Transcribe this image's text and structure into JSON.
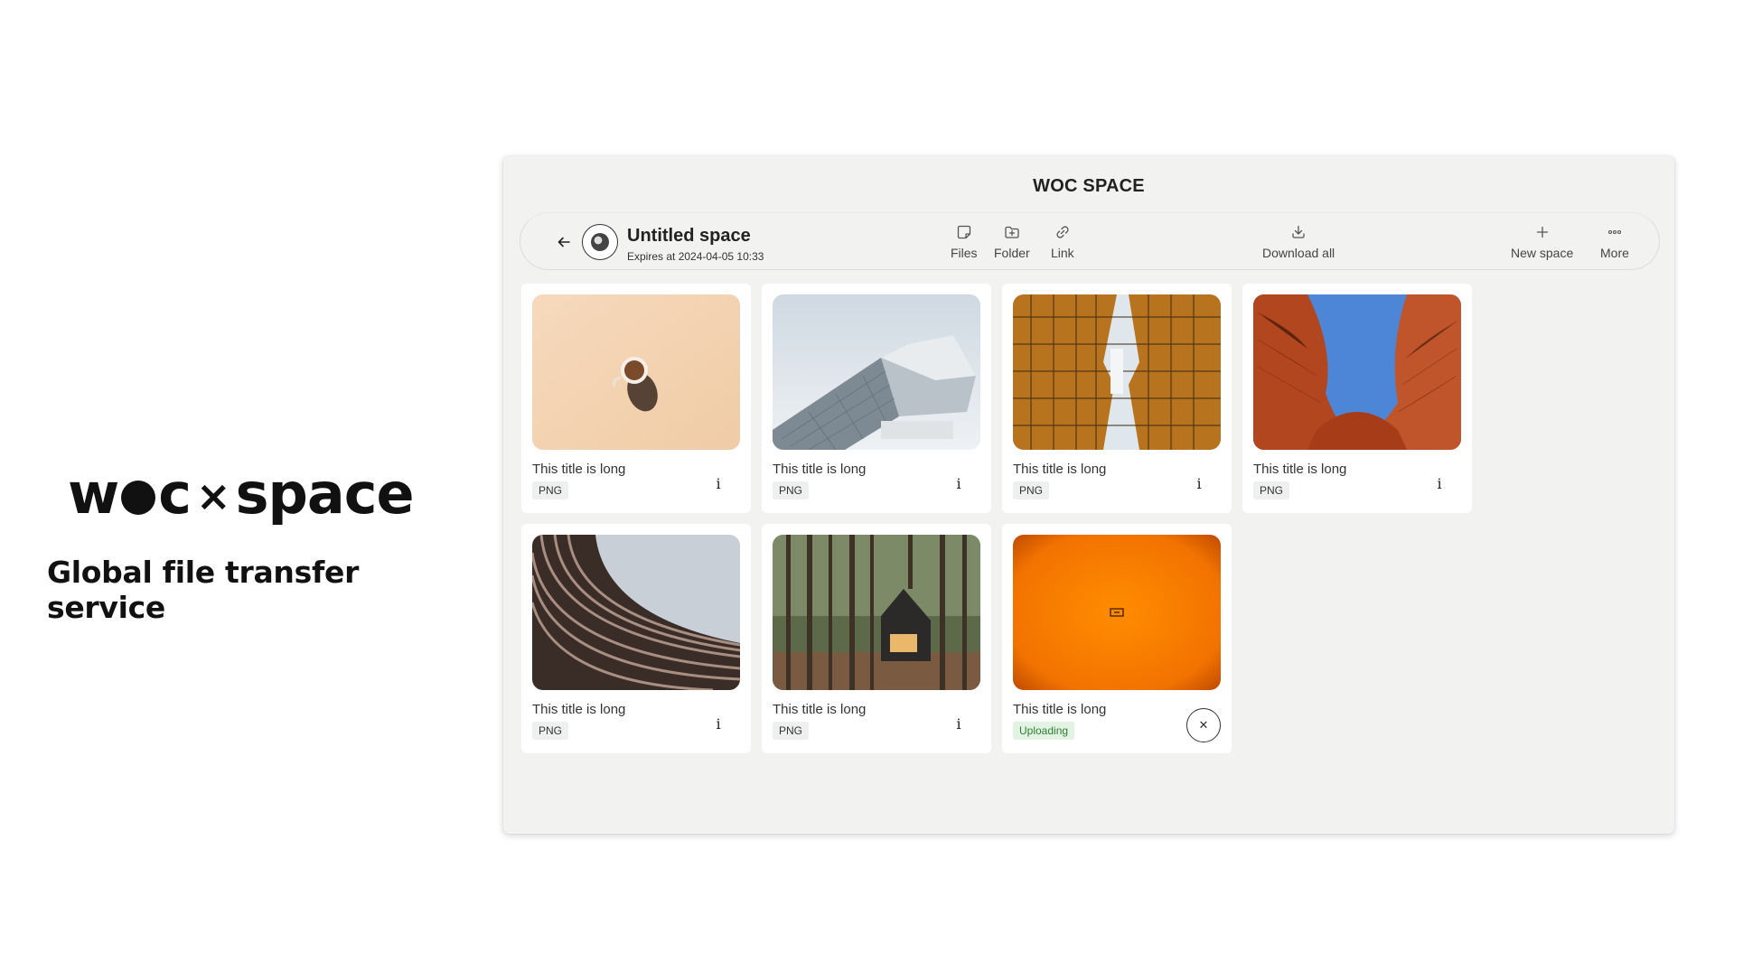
{
  "brand": {
    "logo_w": "w",
    "logo_c": "c",
    "logo_x": "×",
    "logo_space": "space",
    "tagline": "Global file transfer service"
  },
  "window": {
    "title": "WOC SPACE"
  },
  "space": {
    "name": "Untitled space",
    "expires": "Expires at 2024-04-05 10:33"
  },
  "toolbar": {
    "back_icon": "arrow-left-icon",
    "files_label": "Files",
    "folder_label": "Folder",
    "link_label": "Link",
    "download_all_label": "Download all",
    "new_space_label": "New space",
    "more_label": "More"
  },
  "files": [
    {
      "title": "This title is long",
      "badge": "PNG",
      "image": "coffee-cup"
    },
    {
      "title": "This title is long",
      "badge": "PNG",
      "image": "glass-building"
    },
    {
      "title": "This title is long",
      "badge": "PNG",
      "image": "towers-upward"
    },
    {
      "title": "This title is long",
      "badge": "PNG",
      "image": "red-sculpture"
    },
    {
      "title": "This title is long",
      "badge": "PNG",
      "image": "curved-facade"
    },
    {
      "title": "This title is long",
      "badge": "PNG",
      "image": "forest-cabin"
    },
    {
      "title": "This title is long",
      "badge": "Uploading",
      "image": "orange-gradient"
    }
  ],
  "colors": {
    "window_bg": "#f2f2f0",
    "uploading_bg": "#e3f3e3",
    "uploading_text": "#2e7d32"
  }
}
